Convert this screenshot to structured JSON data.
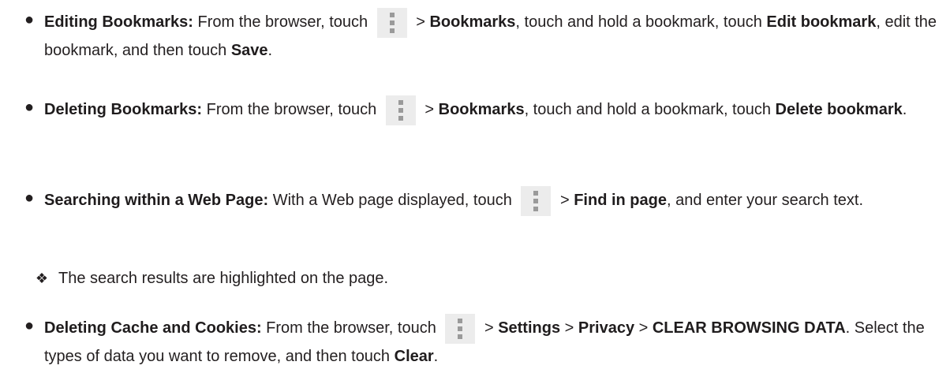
{
  "items": [
    {
      "bullet": "●",
      "title": "Editing Bookmarks:",
      "t1": " From the browser, touch ",
      "icon": "more-vert-icon",
      "t2": " > ",
      "b1": "Bookmarks",
      "t3": ", touch and hold a bookmark, touch ",
      "b2": "Edit bookmark",
      "t4": ", edit the bookmark, and then touch ",
      "b3": "Save",
      "t5": "."
    },
    {
      "bullet": "●",
      "title": "Deleting Bookmarks:",
      "t1": " From the browser, touch ",
      "icon": "more-vert-icon",
      "t2": " > ",
      "b1": "Bookmarks",
      "t3": ", touch and hold a bookmark, touch ",
      "b2": "Delete bookmark",
      "t4": "."
    },
    {
      "bullet": "●",
      "title": "Searching within a Web Page:",
      "t1": " With a Web page displayed, touch ",
      "icon": "more-vert-icon",
      "t2": " > ",
      "b1": "Find in page",
      "t3": ", and enter your search text."
    },
    {
      "bullet": "❖",
      "text": "The search results are highlighted on the page."
    },
    {
      "bullet": "●",
      "title": "Deleting Cache and Cookies:",
      "t1": " From the browser, touch ",
      "icon": "more-vert-icon",
      "t2": " > ",
      "b1": "Settings",
      "t3": " > ",
      "b2": "Privacy",
      "t4": " > ",
      "b3": "CLEAR BROWSING DATA",
      "t5": ". Select the types of data you want to remove, and then touch ",
      "b4": "Clear",
      "t6": "."
    }
  ]
}
